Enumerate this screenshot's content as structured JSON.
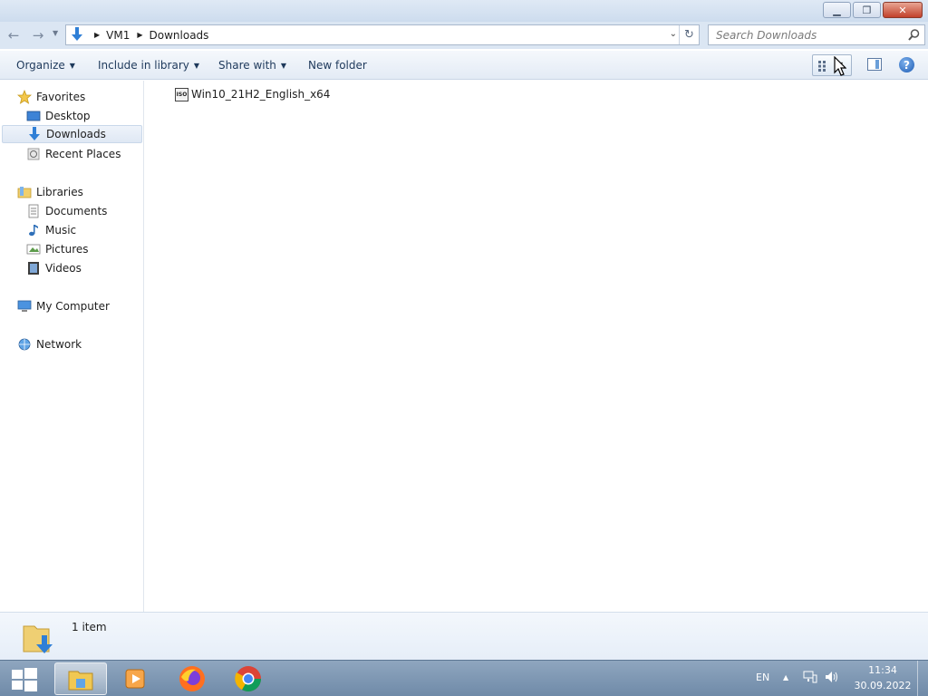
{
  "window": {
    "controls": {
      "minimize_icon": "minimize-icon",
      "restore_icon": "restore-icon",
      "close_icon": "close-icon"
    }
  },
  "nav": {
    "back_icon": "back-arrow-icon",
    "forward_icon": "forward-arrow-icon",
    "recent_icon": "recent-pages-chevron-icon",
    "breadcrumb": [
      "VM1",
      "Downloads"
    ],
    "search_placeholder": "Search Downloads"
  },
  "toolbar": {
    "organize": "Organize",
    "include_in_library": "Include in library",
    "share_with": "Share with",
    "new_folder": "New folder",
    "help_glyph": "?"
  },
  "sidebar": {
    "favorites": {
      "label": "Favorites",
      "items": [
        {
          "label": "Desktop",
          "icon": "desktop-icon"
        },
        {
          "label": "Downloads",
          "icon": "downloads-icon",
          "selected": true
        },
        {
          "label": "Recent Places",
          "icon": "recent-places-icon"
        }
      ]
    },
    "libraries": {
      "label": "Libraries",
      "items": [
        {
          "label": "Documents",
          "icon": "documents-icon"
        },
        {
          "label": "Music",
          "icon": "music-icon"
        },
        {
          "label": "Pictures",
          "icon": "pictures-icon"
        },
        {
          "label": "Videos",
          "icon": "videos-icon"
        }
      ]
    },
    "computer": {
      "label": "My Computer"
    },
    "network": {
      "label": "Network"
    }
  },
  "files": [
    {
      "name": "Win10_21H2_English_x64",
      "icon": "iso-file-icon",
      "badge": "ISO"
    }
  ],
  "details": {
    "count": "1 item"
  },
  "taskbar": {
    "apps": [
      "windows-explorer-icon",
      "media-player-icon",
      "firefox-icon",
      "chrome-icon"
    ],
    "tray": {
      "language": "EN",
      "time": "11:34",
      "date": "30.09.2022"
    }
  },
  "colors": {
    "accent": "#1e395b",
    "selection": "#dfe8f4",
    "taskbar": "#7f98b4"
  }
}
